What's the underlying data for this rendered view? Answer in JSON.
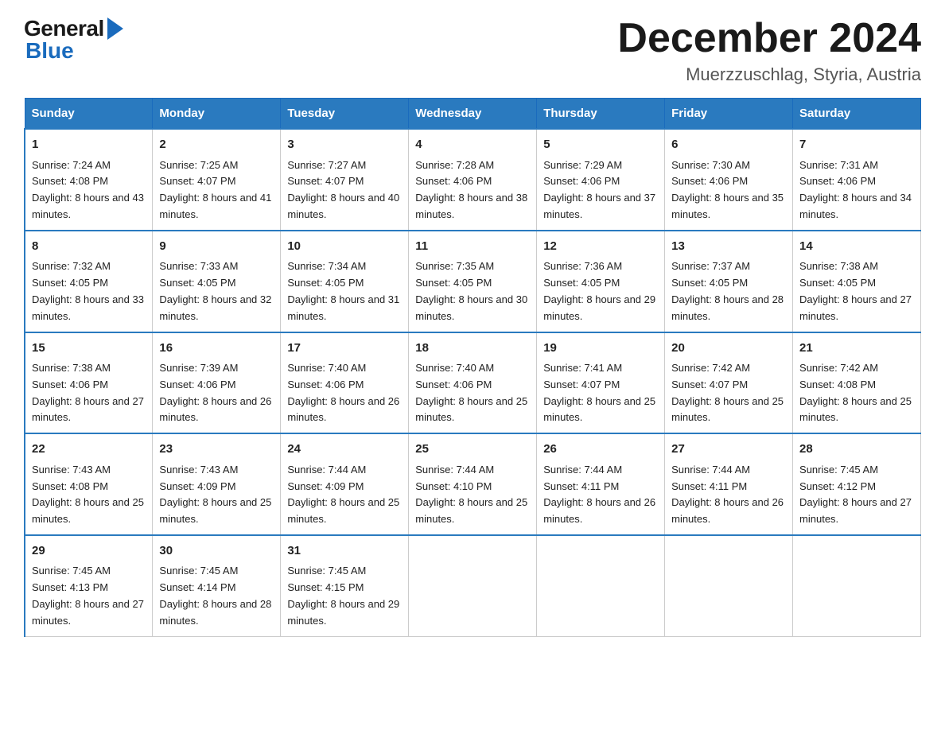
{
  "logo": {
    "general": "General",
    "blue": "Blue"
  },
  "title": "December 2024",
  "subtitle": "Muerzzuschlag, Styria, Austria",
  "weekdays": [
    "Sunday",
    "Monday",
    "Tuesday",
    "Wednesday",
    "Thursday",
    "Friday",
    "Saturday"
  ],
  "weeks": [
    [
      {
        "day": "1",
        "sunrise": "7:24 AM",
        "sunset": "4:08 PM",
        "daylight": "8 hours and 43 minutes."
      },
      {
        "day": "2",
        "sunrise": "7:25 AM",
        "sunset": "4:07 PM",
        "daylight": "8 hours and 41 minutes."
      },
      {
        "day": "3",
        "sunrise": "7:27 AM",
        "sunset": "4:07 PM",
        "daylight": "8 hours and 40 minutes."
      },
      {
        "day": "4",
        "sunrise": "7:28 AM",
        "sunset": "4:06 PM",
        "daylight": "8 hours and 38 minutes."
      },
      {
        "day": "5",
        "sunrise": "7:29 AM",
        "sunset": "4:06 PM",
        "daylight": "8 hours and 37 minutes."
      },
      {
        "day": "6",
        "sunrise": "7:30 AM",
        "sunset": "4:06 PM",
        "daylight": "8 hours and 35 minutes."
      },
      {
        "day": "7",
        "sunrise": "7:31 AM",
        "sunset": "4:06 PM",
        "daylight": "8 hours and 34 minutes."
      }
    ],
    [
      {
        "day": "8",
        "sunrise": "7:32 AM",
        "sunset": "4:05 PM",
        "daylight": "8 hours and 33 minutes."
      },
      {
        "day": "9",
        "sunrise": "7:33 AM",
        "sunset": "4:05 PM",
        "daylight": "8 hours and 32 minutes."
      },
      {
        "day": "10",
        "sunrise": "7:34 AM",
        "sunset": "4:05 PM",
        "daylight": "8 hours and 31 minutes."
      },
      {
        "day": "11",
        "sunrise": "7:35 AM",
        "sunset": "4:05 PM",
        "daylight": "8 hours and 30 minutes."
      },
      {
        "day": "12",
        "sunrise": "7:36 AM",
        "sunset": "4:05 PM",
        "daylight": "8 hours and 29 minutes."
      },
      {
        "day": "13",
        "sunrise": "7:37 AM",
        "sunset": "4:05 PM",
        "daylight": "8 hours and 28 minutes."
      },
      {
        "day": "14",
        "sunrise": "7:38 AM",
        "sunset": "4:05 PM",
        "daylight": "8 hours and 27 minutes."
      }
    ],
    [
      {
        "day": "15",
        "sunrise": "7:38 AM",
        "sunset": "4:06 PM",
        "daylight": "8 hours and 27 minutes."
      },
      {
        "day": "16",
        "sunrise": "7:39 AM",
        "sunset": "4:06 PM",
        "daylight": "8 hours and 26 minutes."
      },
      {
        "day": "17",
        "sunrise": "7:40 AM",
        "sunset": "4:06 PM",
        "daylight": "8 hours and 26 minutes."
      },
      {
        "day": "18",
        "sunrise": "7:40 AM",
        "sunset": "4:06 PM",
        "daylight": "8 hours and 25 minutes."
      },
      {
        "day": "19",
        "sunrise": "7:41 AM",
        "sunset": "4:07 PM",
        "daylight": "8 hours and 25 minutes."
      },
      {
        "day": "20",
        "sunrise": "7:42 AM",
        "sunset": "4:07 PM",
        "daylight": "8 hours and 25 minutes."
      },
      {
        "day": "21",
        "sunrise": "7:42 AM",
        "sunset": "4:08 PM",
        "daylight": "8 hours and 25 minutes."
      }
    ],
    [
      {
        "day": "22",
        "sunrise": "7:43 AM",
        "sunset": "4:08 PM",
        "daylight": "8 hours and 25 minutes."
      },
      {
        "day": "23",
        "sunrise": "7:43 AM",
        "sunset": "4:09 PM",
        "daylight": "8 hours and 25 minutes."
      },
      {
        "day": "24",
        "sunrise": "7:44 AM",
        "sunset": "4:09 PM",
        "daylight": "8 hours and 25 minutes."
      },
      {
        "day": "25",
        "sunrise": "7:44 AM",
        "sunset": "4:10 PM",
        "daylight": "8 hours and 25 minutes."
      },
      {
        "day": "26",
        "sunrise": "7:44 AM",
        "sunset": "4:11 PM",
        "daylight": "8 hours and 26 minutes."
      },
      {
        "day": "27",
        "sunrise": "7:44 AM",
        "sunset": "4:11 PM",
        "daylight": "8 hours and 26 minutes."
      },
      {
        "day": "28",
        "sunrise": "7:45 AM",
        "sunset": "4:12 PM",
        "daylight": "8 hours and 27 minutes."
      }
    ],
    [
      {
        "day": "29",
        "sunrise": "7:45 AM",
        "sunset": "4:13 PM",
        "daylight": "8 hours and 27 minutes."
      },
      {
        "day": "30",
        "sunrise": "7:45 AM",
        "sunset": "4:14 PM",
        "daylight": "8 hours and 28 minutes."
      },
      {
        "day": "31",
        "sunrise": "7:45 AM",
        "sunset": "4:15 PM",
        "daylight": "8 hours and 29 minutes."
      },
      null,
      null,
      null,
      null
    ]
  ]
}
